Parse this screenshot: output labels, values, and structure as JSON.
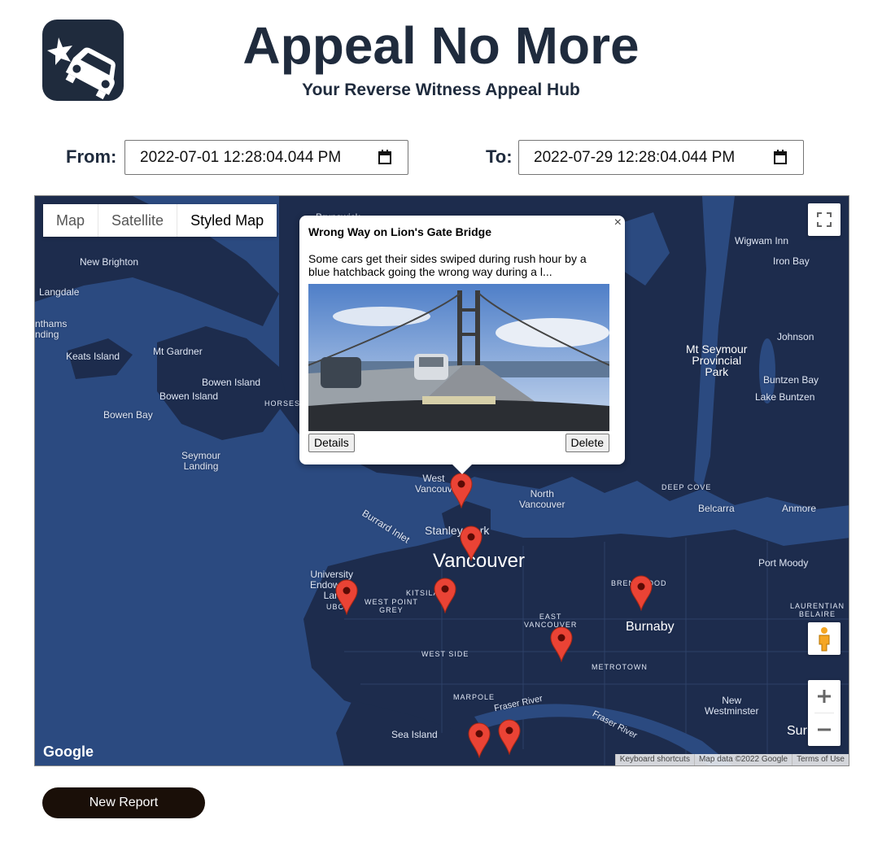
{
  "header": {
    "title": "Appeal No More",
    "subtitle": "Your Reverse Witness Appeal Hub"
  },
  "filters": {
    "from_label": "From:",
    "from_value": "2022-07-01 12:28:04.044 PM",
    "to_label": "To:",
    "to_value": "2022-07-29 12:28:04.044 PM"
  },
  "map": {
    "map_types": [
      "Map",
      "Satellite",
      "Styled Map"
    ],
    "active_map_type": "Styled Map",
    "labels": {
      "brunswick": "Brunswick",
      "wigwam_inn": "Wigwam Inn",
      "new_brighton": "New Brighton",
      "iron_bay": "Iron Bay",
      "langdale": "Langdale",
      "granthams_landing": "nthams\nnding",
      "johnson": "Johnson",
      "keats_island": "Keats Island",
      "mt_gardner": "Mt Gardner",
      "mt_seymour": "Mt Seymour\nProvincial\nPark",
      "bowen_island_1": "Bowen Island",
      "bowen_island_2": "Bowen Island",
      "buntzen_bay": "Buntzen Bay",
      "lake_buntzen": "Lake Buntzen",
      "horseshoe": "HORSESH",
      "bowen_bay": "Bowen Bay",
      "seymour_landing": "Seymour\nLanding",
      "west_vancouver": "West\nVancouv",
      "deep_cove": "DEEP COVE",
      "north_vancouver": "North\nVancouver",
      "belcarra": "Belcarra",
      "anmore": "Anmore",
      "burrard_inlet": "Burrard Inlet",
      "stanley_park": "Stanley Park",
      "vancouver": "Vancouver",
      "port_moody": "Port Moody",
      "university_endowment": "University\nEndowme\nLan",
      "ubc": "UBC",
      "kitsilano": "KITSILA",
      "west_point_grey": "WEST POINT\nGREY",
      "brentwood": "BRENTWOOD",
      "laurentian": "LAURENTIAN\nBELAIRE",
      "east_vancouver": "EAST\nVANCOUVER",
      "burnaby": "Burnaby",
      "west_side": "WEST SIDE",
      "metrotown": "METROTOWN",
      "marpole": "MARPOLE",
      "fraser_river_1": "Fraser River",
      "fraser_river_2": "Fraser River",
      "new_westminster": "New\nWestminster",
      "sea_island": "Sea Island",
      "surrey": "Sur"
    },
    "attribution": [
      "Keyboard shortcuts",
      "Map data ©2022 Google",
      "Terms of Use"
    ],
    "google_logo": "Google"
  },
  "popup": {
    "title": "Wrong Way on Lion's Gate Bridge",
    "description": "Some cars get their sides swiped during rush hour by a blue hatchback going the wrong way during a l...",
    "details_label": "Details",
    "delete_label": "Delete",
    "close_label": "×"
  },
  "new_report_label": "New Report",
  "colors": {
    "brand_dark": "#1f2b3d",
    "map_land": "#1d2c4d",
    "map_water": "#2b4a80",
    "pin": "#ea4335"
  }
}
